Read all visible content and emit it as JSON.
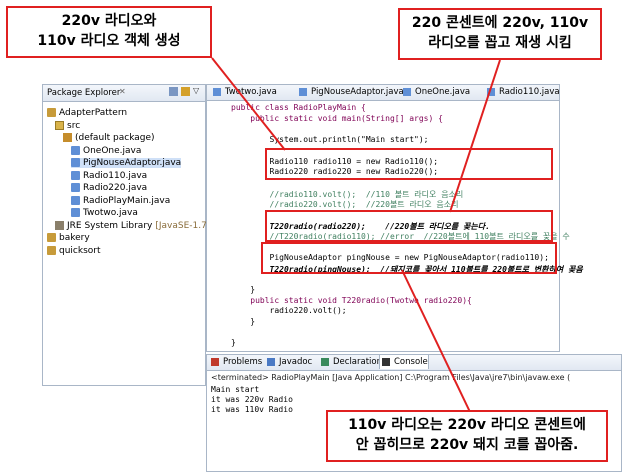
{
  "callouts": {
    "top_left": [
      "220v 라디오와",
      "110v 라디오 객체 생성"
    ],
    "top_right": [
      "220 콘센트에 220v, 110v",
      "라디오를 꼽고 재생 시킴"
    ],
    "bottom": [
      "110v 라디오는 220v 라디오 콘센트에",
      "안 꼽히므로 220v 돼지 코를 꼽아줌."
    ]
  },
  "package_explorer": {
    "title": "Package Explorer",
    "tree": [
      {
        "label": "AdapterPattern",
        "icon": "project-icon"
      },
      {
        "label": "src",
        "icon": "source-folder-icon"
      },
      {
        "label": "(default package)",
        "icon": "package-icon"
      },
      {
        "label": "OneOne.java",
        "icon": "java-file-icon"
      },
      {
        "label": "PigNouseAdaptor.java",
        "icon": "java-file-icon"
      },
      {
        "label": "Radio110.java",
        "icon": "java-file-icon"
      },
      {
        "label": "Radio220.java",
        "icon": "java-file-icon"
      },
      {
        "label": "RadioPlayMain.java",
        "icon": "java-file-icon"
      },
      {
        "label": "Twotwo.java",
        "icon": "java-file-icon"
      },
      {
        "label": "JRE System Library",
        "suffix": "[JavaSE-1.7]",
        "icon": "library-icon"
      },
      {
        "label": "bakery",
        "icon": "project-icon"
      },
      {
        "label": "quicksort",
        "icon": "project-icon"
      }
    ]
  },
  "editor": {
    "tabs": [
      "Twotwo.java",
      "PigNouseAdaptor.java",
      "OneOne.java",
      "Radio110.java"
    ],
    "code": [
      "public class RadioPlayMain {",
      "    public static void main(String[] args) {",
      "",
      "        System.out.println(\"Main start\");",
      "",
      "        Radio110 radio110 = new Radio110();",
      "        Radio220 radio220 = new Radio220();",
      "",
      "        //radio110.volt();  //110 볼트 라디오 음소리",
      "        //radio220.volt();  //220볼트 라디오 음소리",
      "",
      "        T220radio(radio220);    //220볼트 라디오를 꽂는다.",
      "        //T220radio(radio110); //error  //220볼트에 110볼트 라디오를 꽂을 수",
      "",
      "        PigNouseAdaptor pingNouse = new PigNouseAdaptor(radio110);",
      "        T220radio(pingNouse);  //돼지코를 꽂아서 110볼트를 220볼트로 변환하여 꽂음",
      "",
      "    }",
      "    public static void T220radio(Twotwo radio220){",
      "        radio220.volt();",
      "    }",
      "",
      "}"
    ]
  },
  "console": {
    "tabs": [
      "Problems",
      "Javadoc",
      "Declaration",
      "Console"
    ],
    "status": "<terminated> RadioPlayMain [Java Application] C:\\Program Files\\Java\\jre7\\bin\\javaw.exe (",
    "output": [
      "Main start",
      "it was 220v Radio",
      "it was 110v Radio"
    ]
  }
}
